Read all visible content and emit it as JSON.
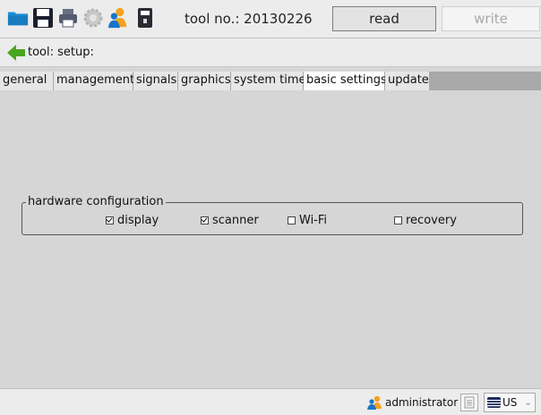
{
  "toolbar": {
    "icons": [
      "folder-icon",
      "save-icon",
      "print-icon",
      "settings-icon",
      "users-icon",
      "usb-device-icon"
    ],
    "tool_no_label": "tool no.: 20130226",
    "read_label": "read",
    "write_label": "write"
  },
  "path": {
    "back_icon": "back-arrow-icon",
    "label": "tool: setup:"
  },
  "tabs": [
    {
      "label": "general",
      "active": false
    },
    {
      "label": "management",
      "active": false
    },
    {
      "label": "signals",
      "active": false
    },
    {
      "label": "graphics",
      "active": false
    },
    {
      "label": "system time",
      "active": false
    },
    {
      "label": "basic settings",
      "active": true
    },
    {
      "label": "update",
      "active": false
    }
  ],
  "hardware": {
    "title": "hardware configuration",
    "options": [
      {
        "label": "display",
        "checked": true
      },
      {
        "label": "scanner",
        "checked": true
      },
      {
        "label": "Wi-Fi",
        "checked": false
      },
      {
        "label": "recovery",
        "checked": false
      }
    ]
  },
  "status": {
    "user": "administrator",
    "language": "US"
  },
  "colors": {
    "toolbar_bg": "#ececec",
    "content_bg": "#d6d6d6",
    "tab_strip_bg": "#a9a9a9",
    "active_tab_bg": "#ffffff",
    "accent_blue": "#1a8ad4",
    "back_arrow_green": "#4aa61f"
  }
}
